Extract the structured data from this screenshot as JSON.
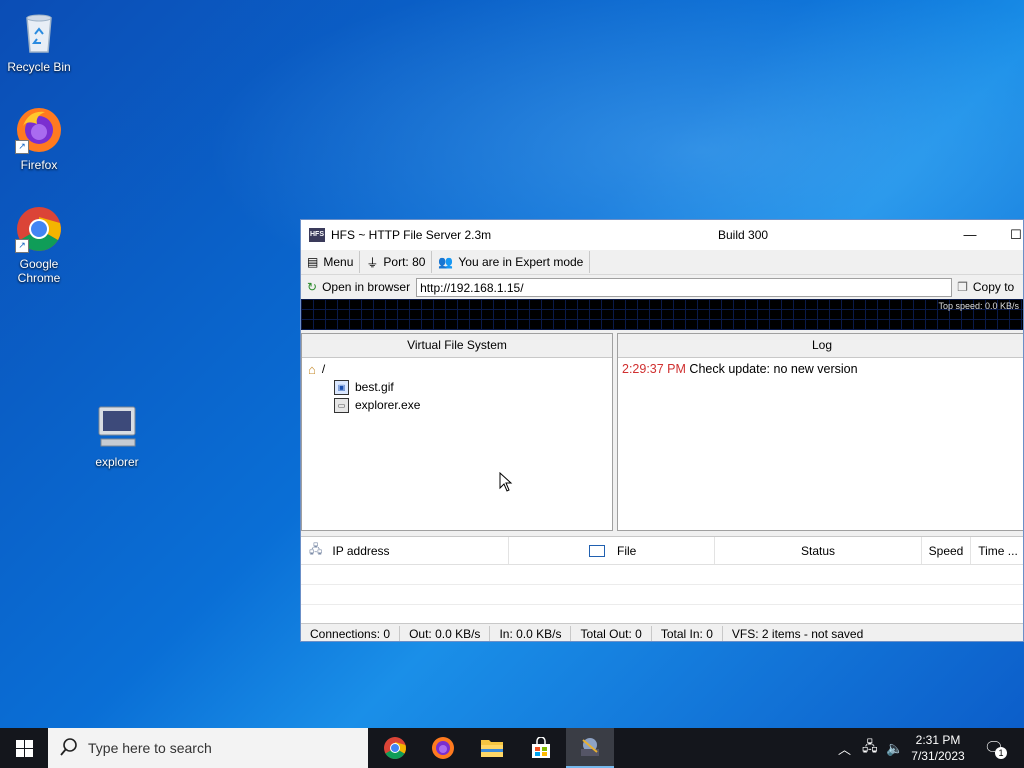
{
  "desktop": {
    "icons": [
      {
        "label": "Recycle Bin"
      },
      {
        "label": "Firefox"
      },
      {
        "label": "Google Chrome"
      },
      {
        "label": "explorer"
      }
    ]
  },
  "window": {
    "title": "HFS ~ HTTP File Server 2.3m",
    "build": "Build 300",
    "toolbar": {
      "menu_label": "Menu",
      "port_label": "Port: 80",
      "mode_label": "You are in Expert mode"
    },
    "urlbar": {
      "open_label": "Open in browser",
      "url": "http://192.168.1.15/",
      "copy_label": "Copy to"
    },
    "graph": {
      "top_speed": "Top speed: 0.0 KB/s"
    },
    "vfs": {
      "header": "Virtual File System",
      "root": "/",
      "items": [
        "best.gif",
        "explorer.exe"
      ]
    },
    "log": {
      "header": "Log",
      "entries": [
        {
          "time": "2:29:37 PM",
          "message": "Check update: no new version"
        }
      ]
    },
    "connections": {
      "columns": [
        "IP address",
        "File",
        "Status",
        "Speed",
        "Time ..."
      ]
    },
    "statusbar": {
      "connections": "Connections: 0",
      "out": "Out: 0.0 KB/s",
      "in": "In: 0.0 KB/s",
      "total_out": "Total Out: 0",
      "total_in": "Total In: 0",
      "vfs": "VFS: 2 items - not saved"
    }
  },
  "taskbar": {
    "search_placeholder": "Type here to search",
    "clock_time": "2:31 PM",
    "clock_date": "7/31/2023",
    "notification_count": "1"
  }
}
